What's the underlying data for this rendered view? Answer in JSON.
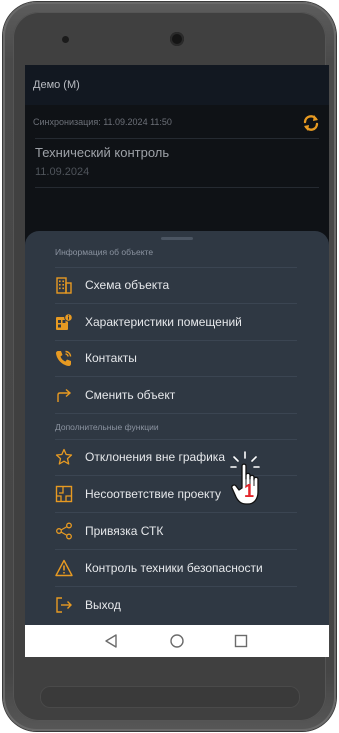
{
  "app": {
    "title": "Демо (М)"
  },
  "sync": {
    "text": "Синхронизация: 11.09.2024 11:50",
    "icon": "sync-icon"
  },
  "document": {
    "title": "Технический контроль",
    "date": "11.09.2024"
  },
  "sheet": {
    "section_object": "Информация об объекте",
    "section_extra": "Дополнительные функции",
    "object_items": [
      {
        "label": "Схема объекта",
        "icon": "building-icon"
      },
      {
        "label": "Характеристики помещений",
        "icon": "room-info-icon"
      },
      {
        "label": "Контакты",
        "icon": "phone-icon"
      },
      {
        "label": "Сменить объект",
        "icon": "switch-arrow-icon"
      }
    ],
    "extra_items": [
      {
        "label": "Отклонения вне графика",
        "icon": "star-icon"
      },
      {
        "label": "Несоответствие проекту",
        "icon": "floorplan-icon"
      },
      {
        "label": "Привязка СТК",
        "icon": "share-icon"
      },
      {
        "label": "Контроль техники безопасности",
        "icon": "warning-icon"
      },
      {
        "label": "Выход",
        "icon": "logout-icon"
      }
    ]
  },
  "annotation": {
    "step": "1"
  },
  "colors": {
    "accent": "#f0a030",
    "sheet": "#2f3843",
    "screen": "#0e1115",
    "annotation": "#e3262b"
  }
}
